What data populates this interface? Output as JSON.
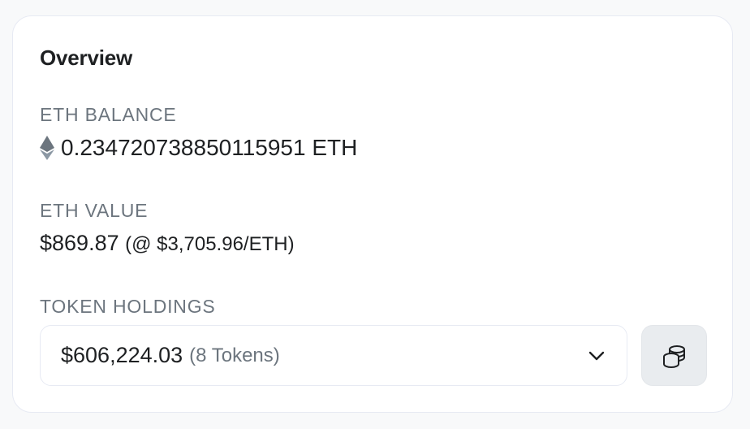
{
  "overview": {
    "title": "Overview",
    "eth_balance": {
      "label": "ETH BALANCE",
      "value": "0.234720738850115951 ETH",
      "icon": "ethereum-icon"
    },
    "eth_value": {
      "label": "ETH VALUE",
      "value": "$869.87",
      "price": "(@ $3,705.96/ETH)"
    },
    "token_holdings": {
      "label": "TOKEN HOLDINGS",
      "amount": "$606,224.03",
      "count": "(8 Tokens)",
      "dropdown_icon": "chevron-down-icon",
      "button_icon": "coins-stack-icon"
    }
  },
  "colors": {
    "card_background": "#ffffff",
    "page_background": "#f8f9fa",
    "border": "#e7eaf3",
    "muted_text": "#6c757e",
    "primary_text": "#1e2022",
    "button_background": "#e9ecef"
  }
}
